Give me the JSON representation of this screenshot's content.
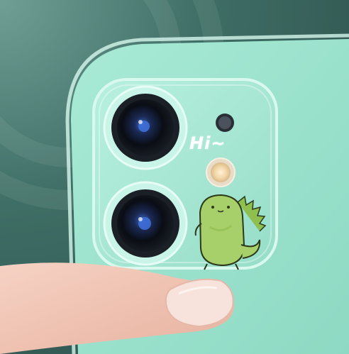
{
  "photo": {
    "description_sticker_text": "Hi~",
    "colors": {
      "phone_body": "#9ee3cf",
      "phone_edge": "#c9f3e6",
      "dino_green": "#a8d06a",
      "dino_spikes": "#8fbf4f",
      "lens_dark": "#0c0f14",
      "lens_blue": "#2d4fa8",
      "flash_warm": "#f2d6a8",
      "finger_skin": "#f1c7b8",
      "background": "#3f6f66"
    },
    "icons": [
      "camera-lens-icon",
      "camera-lens-icon",
      "microphone-icon",
      "flash-icon",
      "dinosaur-sticker-icon"
    ]
  }
}
